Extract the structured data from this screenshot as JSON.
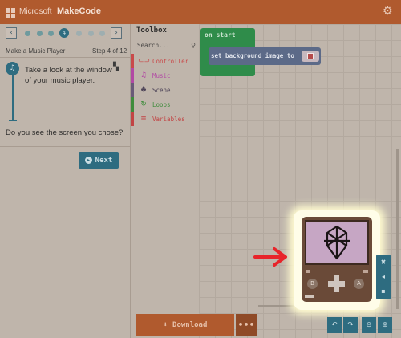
{
  "header": {
    "brand": "Microsoft",
    "product": "MakeCode",
    "settings_icon": "gear-icon"
  },
  "tutorial": {
    "prev_icon": "chevron-left-icon",
    "next_icon": "chevron-right-icon",
    "steps_total": 12,
    "current_step": 4,
    "current_step_label": "4",
    "title": "Make a Music Player",
    "step_label": "Step 4 of 12",
    "body": "Take a look at the window of your music player.",
    "question": "Do you see the screen you chose?",
    "next_label": "Next"
  },
  "toolbox": {
    "title": "Toolbox",
    "search_placeholder": "Search...",
    "items": [
      {
        "label": "Controller",
        "icon": "gamepad-icon",
        "color": "#c94a4a"
      },
      {
        "label": "Music",
        "icon": "headphones-icon",
        "color": "#b24aa4"
      },
      {
        "label": "Scene",
        "icon": "tree-icon",
        "color": "#6a5a78"
      },
      {
        "label": "Loops",
        "icon": "loop-icon",
        "color": "#3f8c3c"
      },
      {
        "label": "Variables",
        "icon": "list-icon",
        "color": "#c24444"
      }
    ]
  },
  "workspace": {
    "on_start": "on start",
    "set_background": "set background image to"
  },
  "bottom": {
    "download_label": "Download",
    "more_label": "•••"
  },
  "colors": {
    "accent": "#b05a2e",
    "teal": "#2e6c80",
    "block_green": "#2f8c4a",
    "block_slate": "#5c6a88"
  }
}
